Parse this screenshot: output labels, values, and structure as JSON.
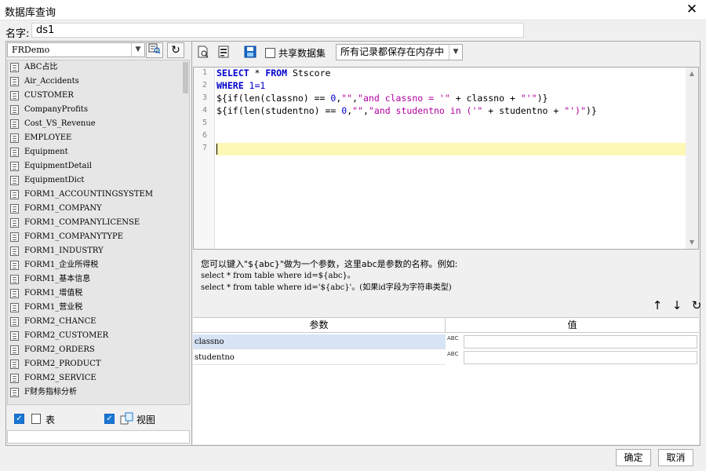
{
  "window": {
    "title": "数据库查询"
  },
  "name_field": {
    "label": "名字:",
    "value": "ds1"
  },
  "datasource": {
    "selected": "FRDemo"
  },
  "tables": [
    "ABC占比",
    "Air_Accidents",
    "CUSTOMER",
    "CompanyProfits",
    "Cost_VS_Revenue",
    "EMPLOYEE",
    "Equipment",
    "EquipmentDetail",
    "EquipmentDict",
    "FORM1_ACCOUNTINGSYSTEM",
    "FORM1_COMPANY",
    "FORM1_COMPANYLICENSE",
    "FORM1_COMPANYTYPE",
    "FORM1_INDUSTRY",
    "FORM1_企业所得税",
    "FORM1_基本信息",
    "FORM1_增值税",
    "FORM1_营业税",
    "FORM2_CHANCE",
    "FORM2_CUSTOMER",
    "FORM2_ORDERS",
    "FORM2_PRODUCT",
    "FORM2_SERVICE",
    "F财务指标分析"
  ],
  "filters": {
    "table_label": "表",
    "view_label": "视图",
    "table_checked": true,
    "view_checked": true
  },
  "toolbar": {
    "share_label": "共享数据集",
    "mode_selected": "所有记录都保存在内存中"
  },
  "sql": {
    "line_numbers": [
      "1",
      "2",
      "3",
      "4",
      "5",
      "6",
      "7"
    ],
    "l1": {
      "kw1": "SELECT",
      "mid": " * ",
      "kw2": "FROM",
      "tail": " Stscore"
    },
    "l2": {
      "kw": "WHERE",
      "num": " 1=1"
    },
    "l3": {
      "a": "${if(len(classno) == ",
      "n": "0",
      "b": ",",
      "s1": "\"\"",
      "c": ",",
      "s2": "\"and classno = '\"",
      "d": " + classno + ",
      "s3": "\"'\"",
      "e": ")}"
    },
    "l4": {
      "a": "${if(len(studentno) == ",
      "n": "0",
      "b": ",",
      "s1": "\"\"",
      "c": ",",
      "s2": "\"and studentno in ('\"",
      "d": " + studentno + ",
      "s3": "\"')\"",
      "e": ")}"
    }
  },
  "hint": {
    "line1": "您可以键入\"${abc}\"做为一个参数，这里abc是参数的名称。例如:",
    "line2": "select * from table where id=${abc}。",
    "line3": "select * from table where id='${abc}'。(如果id字段为字符串类型)"
  },
  "params": {
    "col_name": "参数",
    "col_value": "值",
    "type_label": "ABC",
    "rows": [
      {
        "name": "classno",
        "value": ""
      },
      {
        "name": "studentno",
        "value": ""
      }
    ]
  },
  "buttons": {
    "ok": "确定",
    "cancel": "取消"
  },
  "colors": {
    "keyword": "#0000cc",
    "string": "#b000a0",
    "current_line": "#fdf8b4",
    "check": "#1976d2",
    "selected_row": "#d6e4f5"
  }
}
